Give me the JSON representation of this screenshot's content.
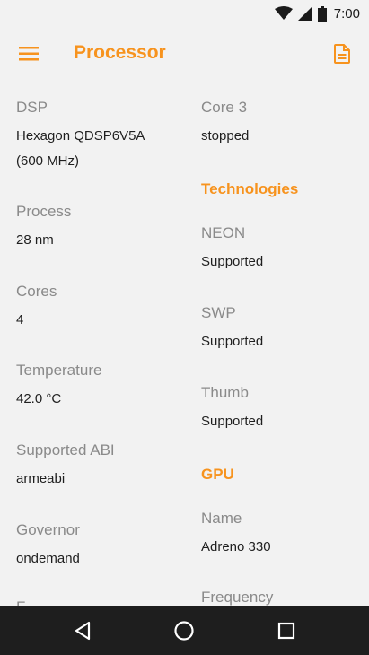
{
  "status": {
    "time": "7:00"
  },
  "appbar": {
    "title": "Processor",
    "accent": "#f7931e"
  },
  "left": {
    "dsp_label": "DSP",
    "dsp_value_line1": "Hexagon QDSP6V5A",
    "dsp_value_line2": "(600 MHz)",
    "process_label": "Process",
    "process_value": "28 nm",
    "cores_label": "Cores",
    "cores_value": "4",
    "temperature_label": "Temperature",
    "temperature_value": "42.0 °C",
    "abi_label": "Supported ABI",
    "abi_value": "armeabi",
    "governor_label": "Governor",
    "governor_value": "ondemand",
    "next_label": "F"
  },
  "right": {
    "core3_label": "Core 3",
    "core3_value": "stopped",
    "technologies_heading": "Technologies",
    "neon_label": "NEON",
    "neon_value": "Supported",
    "swp_label": "SWP",
    "swp_value": "Supported",
    "thumb_label": "Thumb",
    "thumb_value": "Supported",
    "gpu_heading": "GPU",
    "gpu_name_label": "Name",
    "gpu_name_value": "Adreno 330",
    "frequency_label": "Frequency"
  },
  "icons": {
    "menu": "hamburger-menu-icon",
    "doc": "document-icon",
    "back": "back-triangle-icon",
    "home": "home-circle-icon",
    "recents": "recents-square-icon"
  }
}
